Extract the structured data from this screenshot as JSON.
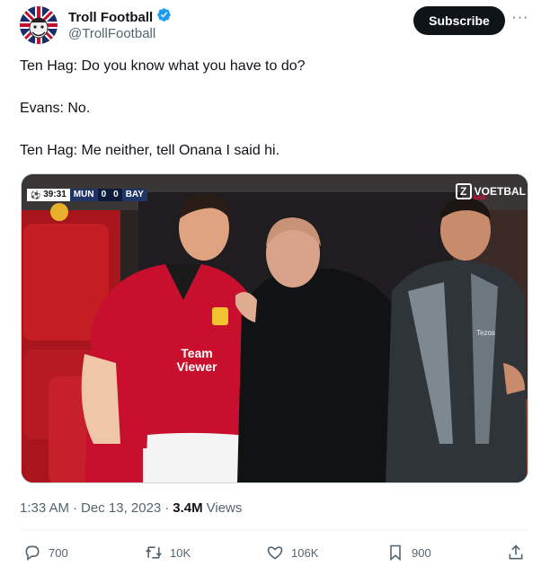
{
  "author": {
    "display_name": "Troll Football",
    "handle": "@TrollFootball",
    "verified": true
  },
  "header": {
    "subscribe_label": "Subscribe",
    "more_label": "···"
  },
  "tweet": {
    "lines": [
      "Ten Hag: Do you know what you have to do?",
      "Evans: No.",
      "Ten Hag: Me neither, tell Onana I said hi."
    ]
  },
  "media": {
    "scorebug": {
      "time": "39:31",
      "home_team": "MUN",
      "home_score": "0",
      "away_score": "0",
      "away_team": "BAY"
    },
    "broadcaster": {
      "logo_letter": "Z",
      "name": "VOETBAL",
      "live_tag": "LIVE"
    },
    "shirt_sponsor": "Team Viewer",
    "jacket_text": "Tezos"
  },
  "meta": {
    "time": "1:33 AM",
    "separator": "·",
    "date": "Dec 13, 2023",
    "views_count": "3.4M",
    "views_label": "Views"
  },
  "actions": {
    "replies": "700",
    "reposts": "10K",
    "likes": "106K",
    "bookmarks": "900"
  },
  "colors": {
    "verified_blue": "#1d9bf0",
    "secondary_text": "#536471",
    "primary_text": "#0f1419",
    "united_red": "#c8102e"
  }
}
